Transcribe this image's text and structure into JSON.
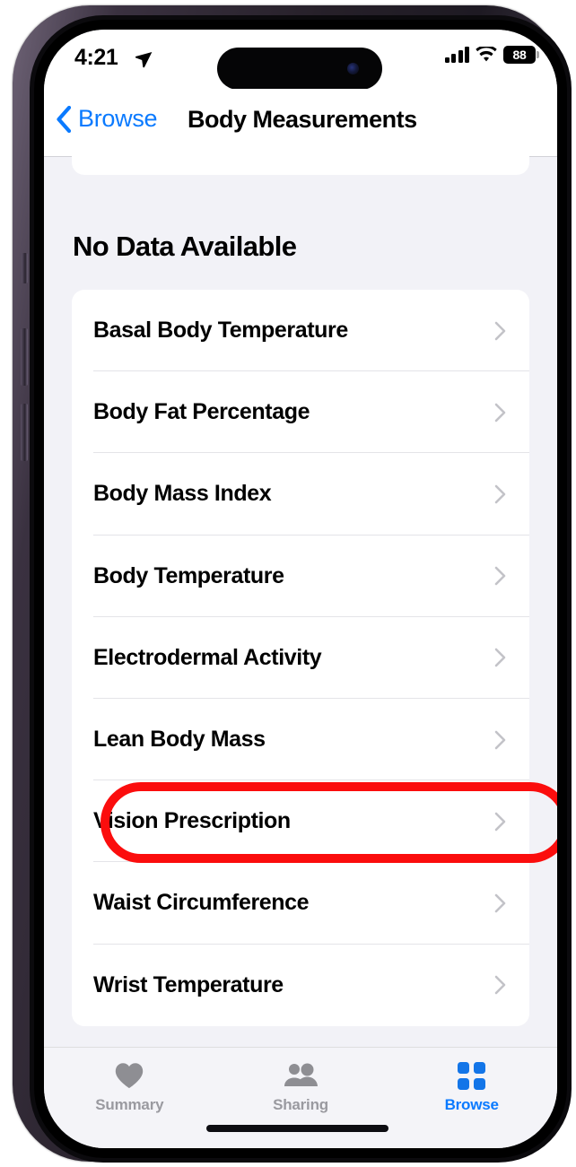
{
  "device": {
    "name": "iPhone 14 Pro",
    "frame_color": "#3a3140"
  },
  "status_bar": {
    "time": "4:21",
    "location_icon": "location-arrow-icon",
    "signal_icon": "cellular-signal-icon",
    "wifi_icon": "wifi-icon",
    "battery_percent": "88"
  },
  "nav_bar": {
    "back_label": "Browse",
    "back_icon": "chevron-left-icon",
    "title": "Body Measurements"
  },
  "content": {
    "section_header": "No Data Available",
    "rows": [
      {
        "label": "Basal Body Temperature",
        "chevron": "chevron-right-icon",
        "highlighted": false
      },
      {
        "label": "Body Fat Percentage",
        "chevron": "chevron-right-icon",
        "highlighted": false
      },
      {
        "label": "Body Mass Index",
        "chevron": "chevron-right-icon",
        "highlighted": false
      },
      {
        "label": "Body Temperature",
        "chevron": "chevron-right-icon",
        "highlighted": false
      },
      {
        "label": "Electrodermal Activity",
        "chevron": "chevron-right-icon",
        "highlighted": false
      },
      {
        "label": "Lean Body Mass",
        "chevron": "chevron-right-icon",
        "highlighted": false
      },
      {
        "label": "Vision Prescription",
        "chevron": "chevron-right-icon",
        "highlighted": true
      },
      {
        "label": "Waist Circumference",
        "chevron": "chevron-right-icon",
        "highlighted": false
      },
      {
        "label": "Wrist Temperature",
        "chevron": "chevron-right-icon",
        "highlighted": false
      }
    ]
  },
  "annotation": {
    "target": "Vision Prescription",
    "shape": "rounded-rectangle-outline",
    "color": "#fb0d0d"
  },
  "tab_bar": {
    "tabs": [
      {
        "label": "Summary",
        "icon": "heart-icon",
        "active": false
      },
      {
        "label": "Sharing",
        "icon": "two-people-icon",
        "active": false
      },
      {
        "label": "Browse",
        "icon": "grid-squares-icon",
        "active": true
      }
    ],
    "active_color": "#0a7aff",
    "inactive_color": "#9a9aa0"
  }
}
